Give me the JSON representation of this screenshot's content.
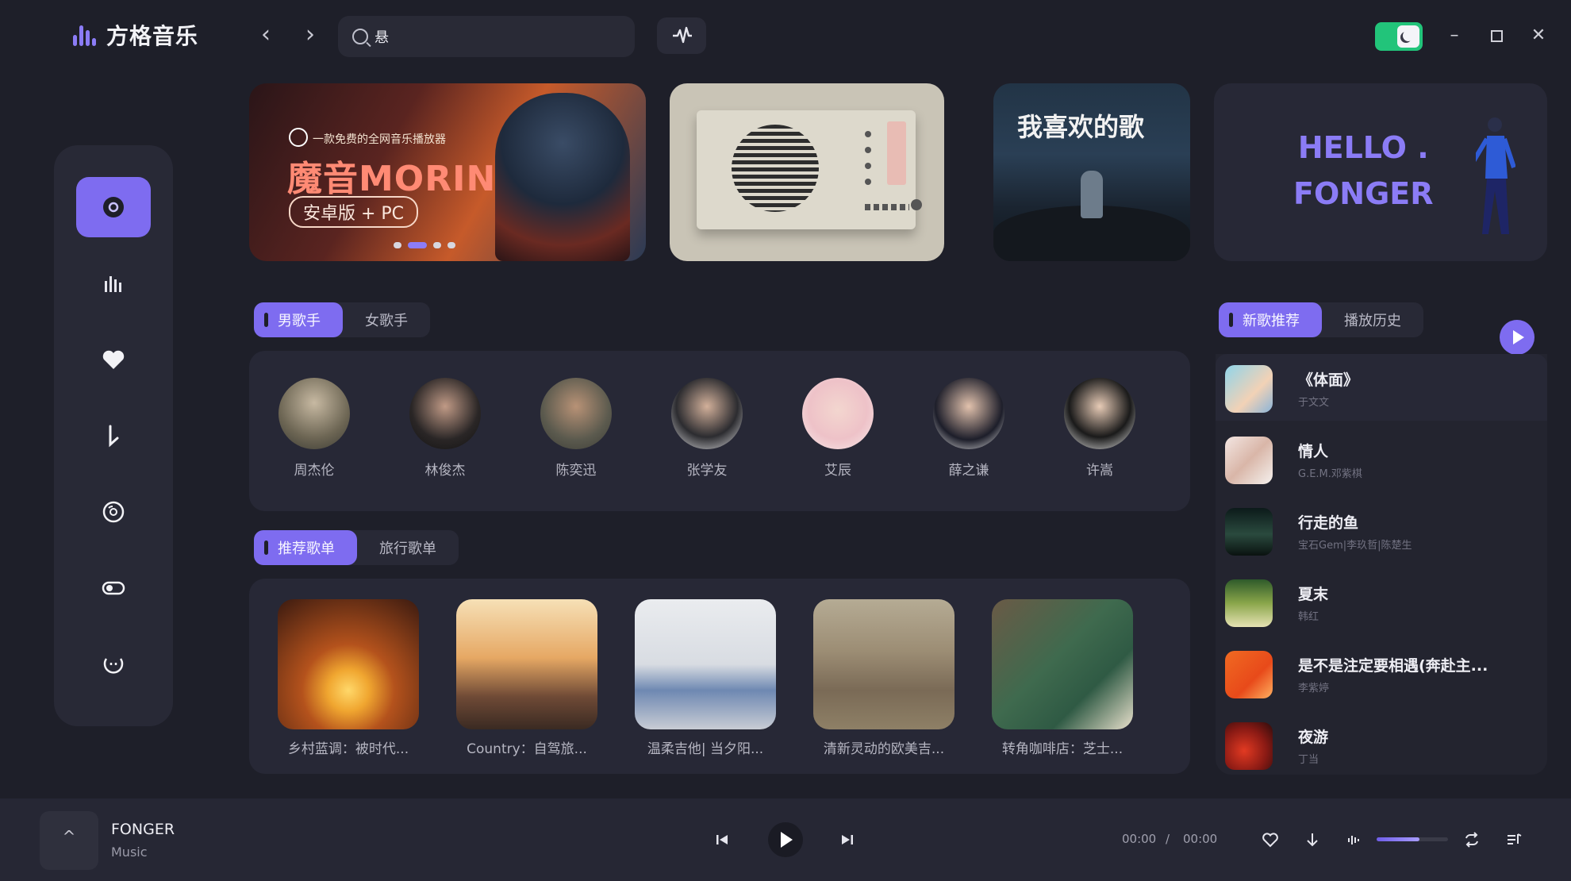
{
  "app": {
    "name": "方格音乐",
    "brand_color": "#7e6cf0"
  },
  "search": {
    "value": "悬",
    "placeholder": ""
  },
  "banners": {
    "b1_sub": "一款免费的全网音乐播放器",
    "b1_title": "魔音MORIN",
    "b1_tag": "安卓版 + PC",
    "b3_title": "我喜欢的歌",
    "b4_line1": "HELLO .",
    "b4_line2": "FONGER"
  },
  "singer_tabs": [
    {
      "label": "男歌手",
      "active": true
    },
    {
      "label": "女歌手",
      "active": false
    }
  ],
  "artists": [
    "周杰伦",
    "林俊杰",
    "陈奕迅",
    "张学友",
    "艾辰",
    "薛之谦",
    "许嵩"
  ],
  "playlist_tabs": [
    {
      "label": "推荐歌单",
      "active": true
    },
    {
      "label": "旅行歌单",
      "active": false
    }
  ],
  "playlists": [
    "乡村蓝调：被时代...",
    "Country：自驾旅...",
    "温柔吉他| 当夕阳...",
    "清新灵动的欧美吉...",
    "转角咖啡店：芝士..."
  ],
  "song_tabs": [
    {
      "label": "新歌推荐",
      "active": true
    },
    {
      "label": "播放历史",
      "active": false
    }
  ],
  "songs": [
    {
      "title": "《体面》",
      "artist": "于文文"
    },
    {
      "title": "情人",
      "artist": "G.E.M.邓紫棋"
    },
    {
      "title": "行走的鱼",
      "artist": "宝石Gem|李玖哲|陈楚生"
    },
    {
      "title": "夏末",
      "artist": "韩红"
    },
    {
      "title": "是不是注定要相遇(奔赴主...",
      "artist": "李紫婷"
    },
    {
      "title": "夜游",
      "artist": "丁当"
    }
  ],
  "player": {
    "mini_cover_symbol": "^",
    "title": "FONGER",
    "subtitle": "Music",
    "current_time": "00:00",
    "separator": "/",
    "total_time": "00:00",
    "volume": 0.6
  }
}
